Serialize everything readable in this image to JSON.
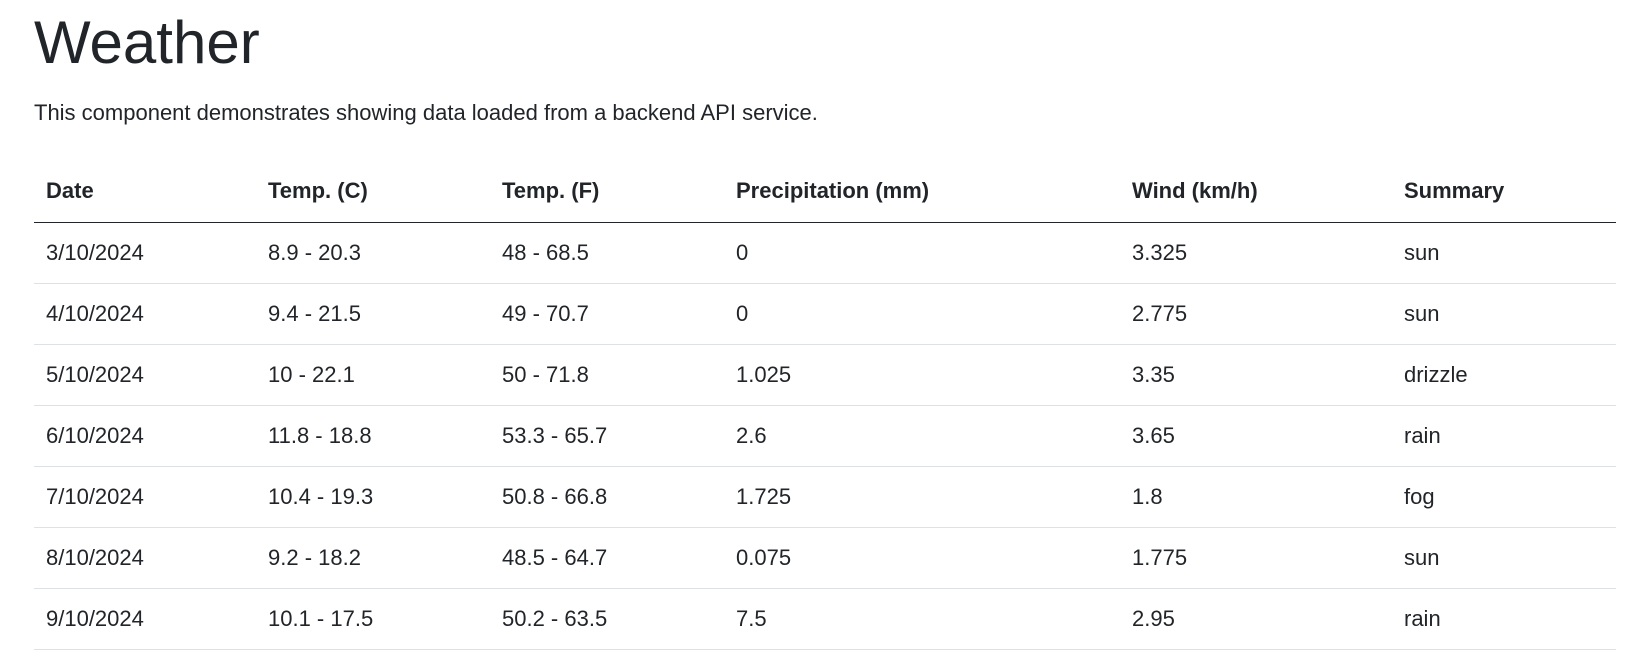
{
  "page": {
    "title": "Weather",
    "description": "This component demonstrates showing data loaded from a backend API service."
  },
  "table": {
    "headers": [
      "Date",
      "Temp. (C)",
      "Temp. (F)",
      "Precipitation (mm)",
      "Wind (km/h)",
      "Summary"
    ],
    "rows": [
      [
        "3/10/2024",
        "8.9 - 20.3",
        "48 - 68.5",
        "0",
        "3.325",
        "sun"
      ],
      [
        "4/10/2024",
        "9.4 - 21.5",
        "49 - 70.7",
        "0",
        "2.775",
        "sun"
      ],
      [
        "5/10/2024",
        "10 - 22.1",
        "50 - 71.8",
        "1.025",
        "3.35",
        "drizzle"
      ],
      [
        "6/10/2024",
        "11.8 - 18.8",
        "53.3 - 65.7",
        "2.6",
        "3.65",
        "rain"
      ],
      [
        "7/10/2024",
        "10.4 - 19.3",
        "50.8 - 66.8",
        "1.725",
        "1.8",
        "fog"
      ],
      [
        "8/10/2024",
        "9.2 - 18.2",
        "48.5 - 64.7",
        "0.075",
        "1.775",
        "sun"
      ],
      [
        "9/10/2024",
        "10.1 - 17.5",
        "50.2 - 63.5",
        "7.5",
        "2.95",
        "rain"
      ]
    ]
  }
}
